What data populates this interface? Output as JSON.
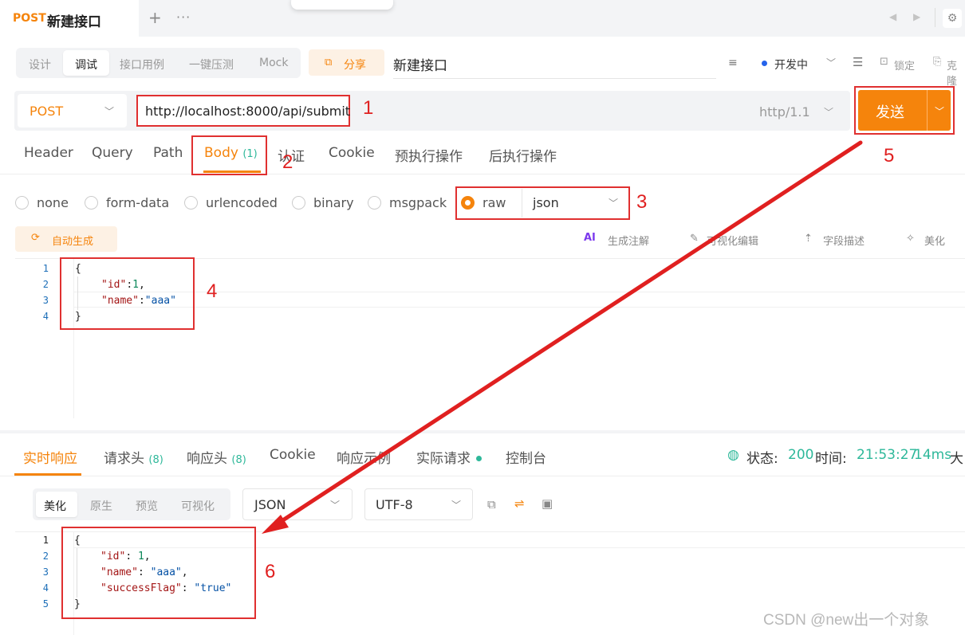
{
  "tab": {
    "method": "POST",
    "title": "新建接口",
    "add": "+",
    "more": "···"
  },
  "nav": {
    "prev": "◀",
    "next": "▶",
    "settings": "⚙"
  },
  "modes": [
    "设计",
    "调试",
    "接口用例",
    "一键压测",
    "Mock"
  ],
  "share": {
    "icon": "⧉",
    "label": "分享"
  },
  "api_name": "新建接口",
  "status": {
    "label": "开发中",
    "color": "#2563eb"
  },
  "actions": {
    "format_icon": "≡",
    "toc_icon": "☰",
    "lock_icon": "🔒",
    "lock": "锁定",
    "clone_icon": "⎘",
    "clone": "克隆"
  },
  "request": {
    "method": "POST",
    "url": "http://localhost:8000/api/submit",
    "http_version": "http/1.1",
    "send": "发送",
    "tabs": [
      "Header",
      "Query",
      "Path",
      "Body",
      "认证",
      "Cookie",
      "预执行操作",
      "后执行操作"
    ],
    "body_count": "(1)",
    "body_types": [
      "none",
      "form-data",
      "urlencoded",
      "binary",
      "msgpack",
      "raw"
    ],
    "raw_format": "json",
    "autogen": "自动生成",
    "tools": [
      "生成注解",
      "可视化编辑",
      "字段描述",
      "美化"
    ],
    "ai_badge": "AI",
    "code_lines": [
      "1",
      "2",
      "3",
      "4"
    ],
    "code": {
      "open": "{",
      "k1": "\"id\"",
      "v1": "1",
      "k2": "\"name\"",
      "v2": "\"aaa\"",
      "close": "}"
    }
  },
  "response": {
    "tabs": [
      "实时响应",
      "请求头",
      "响应头",
      "Cookie",
      "响应示例",
      "实际请求",
      "控制台"
    ],
    "req_headers_count": "(8)",
    "res_headers_count": "(8)",
    "status_label": "状态:",
    "status_code": "200",
    "time_label": "时间:",
    "time": "21:53:27",
    "duration": "14ms",
    "size_label": "大",
    "views": [
      "美化",
      "原生",
      "预览",
      "可视化"
    ],
    "format": "JSON",
    "encoding": "UTF-8",
    "code_lines": [
      "1",
      "2",
      "3",
      "4",
      "5"
    ],
    "code": {
      "open": "{",
      "k1": "\"id\"",
      "v1": "1",
      "k2": "\"name\"",
      "v2": "\"aaa\"",
      "k3": "\"successFlag\"",
      "v3": "\"true\"",
      "close": "}"
    }
  },
  "annotations": [
    "1",
    "2",
    "3",
    "4",
    "5",
    "6"
  ],
  "watermark": "CSDN @new出一个对象",
  "colors": {
    "accent": "#f5840c",
    "annotation": "#e02020",
    "success": "#2eb89a"
  }
}
